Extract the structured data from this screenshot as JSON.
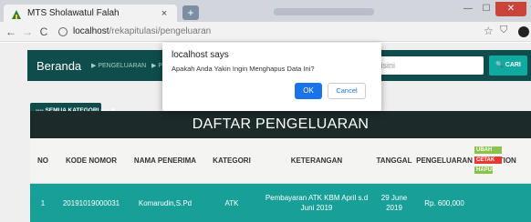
{
  "browser": {
    "tab_title": "MTS Sholawatul Falah",
    "tab_close": "×",
    "new_tab": "+",
    "url_host": "localhost",
    "url_path": "/rekapitulasi/pengeluaran",
    "win_min": "—",
    "win_max": "☐",
    "win_close": "✕"
  },
  "navbar": {
    "brand": "Beranda",
    "menu": [
      "PENGELUARAN",
      "PEN"
    ],
    "search_placeholder": "ari disini",
    "search_button": "CARI"
  },
  "filter": {
    "label": "---- SEMUA KATEGORI ----",
    "caret": "▾"
  },
  "table": {
    "title": "DAFTAR PENGELUARAN",
    "headers": [
      "NO",
      "KODE NOMOR",
      "NAMA PENERIMA",
      "KATEGORI",
      "KETERANGAN",
      "TANGGAL",
      "PENGELUARAN",
      "ACTION"
    ],
    "rows": [
      {
        "no": "1",
        "kode": "20191019000031",
        "nama": "Komarudin,S.Pd",
        "kategori": "ATK",
        "keterangan": "Pembayaran ATK KBM April s.d Juni 2019",
        "tanggal": "29 June 2019",
        "pengeluaran": "Rp. 600,000",
        "actions": [
          "UBAH",
          "CETAK",
          "HAPUS"
        ]
      }
    ]
  },
  "dialog": {
    "title": "localhost says",
    "message": "Apakah Anda Yakin Ingin Menghapus Data Ini?",
    "ok": "OK",
    "cancel": "Cancel"
  }
}
